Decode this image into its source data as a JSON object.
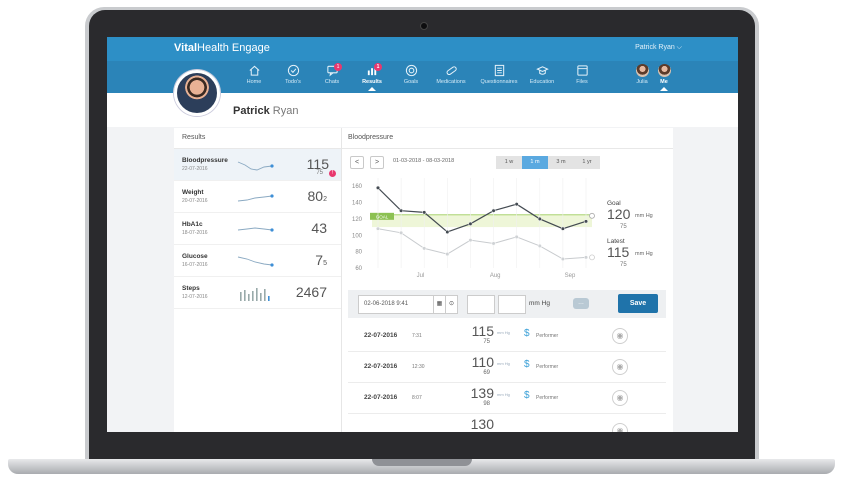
{
  "app": {
    "brand_bold": "Vital",
    "brand_rest": "Health Engage",
    "user_menu": "Patrick Ryan  ⌵"
  },
  "nav": [
    {
      "label": "Home",
      "icon": "home-icon"
    },
    {
      "label": "Todo's",
      "icon": "check-circle-icon"
    },
    {
      "label": "Chats",
      "icon": "chat-icon",
      "badge": "1"
    },
    {
      "label": "Results",
      "icon": "bar-chart-icon",
      "badge": "1",
      "active": true
    },
    {
      "label": "Goals",
      "icon": "target-icon"
    },
    {
      "label": "Medications",
      "icon": "pill-icon"
    },
    {
      "label": "Questionnaires",
      "icon": "list-icon"
    },
    {
      "label": "Education",
      "icon": "graduation-cap-icon"
    },
    {
      "label": "Files",
      "icon": "folder-icon"
    },
    {
      "label": "Julia",
      "icon": "avatar"
    },
    {
      "label": "Me",
      "icon": "avatar",
      "active": true
    }
  ],
  "profile": {
    "first": "Patrick",
    "last": " Ryan"
  },
  "results_panel": {
    "title": "Results",
    "items": [
      {
        "name": "Bloodpressure",
        "date": "22-07-2016",
        "value": "115",
        "sub": "75",
        "alert": "!"
      },
      {
        "name": "Weight",
        "date": "20-07-2016",
        "value": "80",
        "sub": "2"
      },
      {
        "name": "HbA1c",
        "date": "18-07-2016",
        "value": "43",
        "sub": ""
      },
      {
        "name": "Glucose",
        "date": "16-07-2016",
        "value": "7",
        "sub": "5"
      },
      {
        "name": "Steps",
        "date": "12-07-2016",
        "value": "2467",
        "sub": ""
      }
    ]
  },
  "detail": {
    "title": "Bloodpressure",
    "prev": "<",
    "next": ">",
    "date_range": "01-03-2018 - 08-03-2018",
    "ranges": [
      "1 w",
      "1 m",
      "3 m",
      "1 yr"
    ],
    "active_range": "1 m"
  },
  "chart_data": {
    "type": "line",
    "yticks": [
      160,
      140,
      120,
      100,
      80,
      60
    ],
    "ylim": [
      60,
      170
    ],
    "xticks": [
      "Jul",
      "Aug",
      "Sep"
    ],
    "goal_band": [
      110,
      125
    ],
    "goal_label": "GOAL",
    "series": [
      {
        "name": "",
        "values": [
          158,
          130,
          128,
          104,
          114,
          130,
          138,
          120,
          108,
          117
        ]
      },
      {
        "name": "",
        "values": [
          108,
          103,
          84,
          77,
          94,
          90,
          98,
          87,
          71,
          73
        ]
      }
    ],
    "goal_text": "Goal",
    "goal_sys": "120",
    "goal_dia": "75",
    "latest_text": "Latest",
    "latest_sys": "115",
    "latest_dia": "75",
    "unit": "mm Hg"
  },
  "entry": {
    "datetime": "02-06-2018 9:41",
    "cal_icon": "▦",
    "clock_icon": "⊙",
    "unit": "mm Hg",
    "chat": "…",
    "save": "Save"
  },
  "measurements": [
    {
      "date": "22-07-2016",
      "time": "7:31",
      "sys": "115",
      "dia": "75",
      "unit": "mm Hg",
      "performer": "Performer"
    },
    {
      "date": "22-07-2016",
      "time": "12:30",
      "sys": "110",
      "dia": "69",
      "unit": "mm Hg",
      "performer": "Performer"
    },
    {
      "date": "22-07-2016",
      "time": "8:07",
      "sys": "139",
      "dia": "98",
      "unit": "mm Hg",
      "performer": "Performer"
    },
    {
      "date": "",
      "time": "",
      "sys": "130",
      "dia": "",
      "unit": "",
      "performer": ""
    }
  ]
}
